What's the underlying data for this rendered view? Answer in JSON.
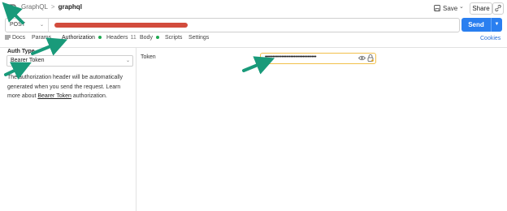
{
  "breadcrumb": {
    "parent": "GraphQL",
    "separator": ">",
    "current": "graphql"
  },
  "header_actions": {
    "save_label": "Save",
    "share_label": "Share",
    "icons": [
      "save-icon",
      "chevron-down-icon",
      "link-icon"
    ]
  },
  "request": {
    "method": "POST",
    "url_redacted": true,
    "send_label": "Send"
  },
  "tabs": [
    {
      "label": "Docs",
      "icon": "docs-icon"
    },
    {
      "label": "Params"
    },
    {
      "label": "Authorization",
      "indicator": "dot",
      "active": true
    },
    {
      "label": "Headers",
      "badge": "11"
    },
    {
      "label": "Body",
      "indicator": "dot"
    },
    {
      "label": "Scripts"
    },
    {
      "label": "Settings"
    }
  ],
  "cookies_label": "Cookies",
  "auth": {
    "type_label": "Auth Type",
    "type_value": "Bearer Token",
    "description_pre": "The authorization header will be automatically generated when you send the request. Learn more about ",
    "description_link": "Bearer Token",
    "description_post": " authorization."
  },
  "token": {
    "label": "Token",
    "masked_value": "••••••••••••••••••••••••••••••••••",
    "icons": [
      "eye-icon",
      "lock-warning-icon"
    ]
  },
  "colors": {
    "accent": "#2a7ff0",
    "active_dot": "#1faa52",
    "focus_border": "#f2c04b",
    "redaction": "#d24c3d",
    "annotation_arrow": "#199a7a"
  }
}
